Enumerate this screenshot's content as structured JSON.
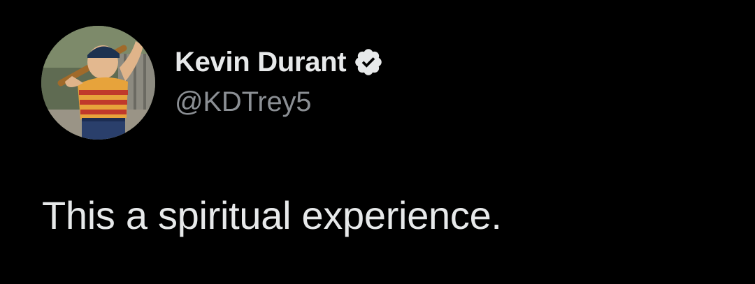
{
  "tweet": {
    "author": {
      "display_name": "Kevin Durant",
      "handle": "@KDTrey5",
      "verified": true,
      "avatar_icon": "profile-photo-boy-with-baseball-bat"
    },
    "text": "This a spiritual experience."
  },
  "colors": {
    "background": "#000000",
    "primary_text": "#e7e9ea",
    "secondary_text": "#8b8f94",
    "verified_badge": "#e7e9ea"
  }
}
